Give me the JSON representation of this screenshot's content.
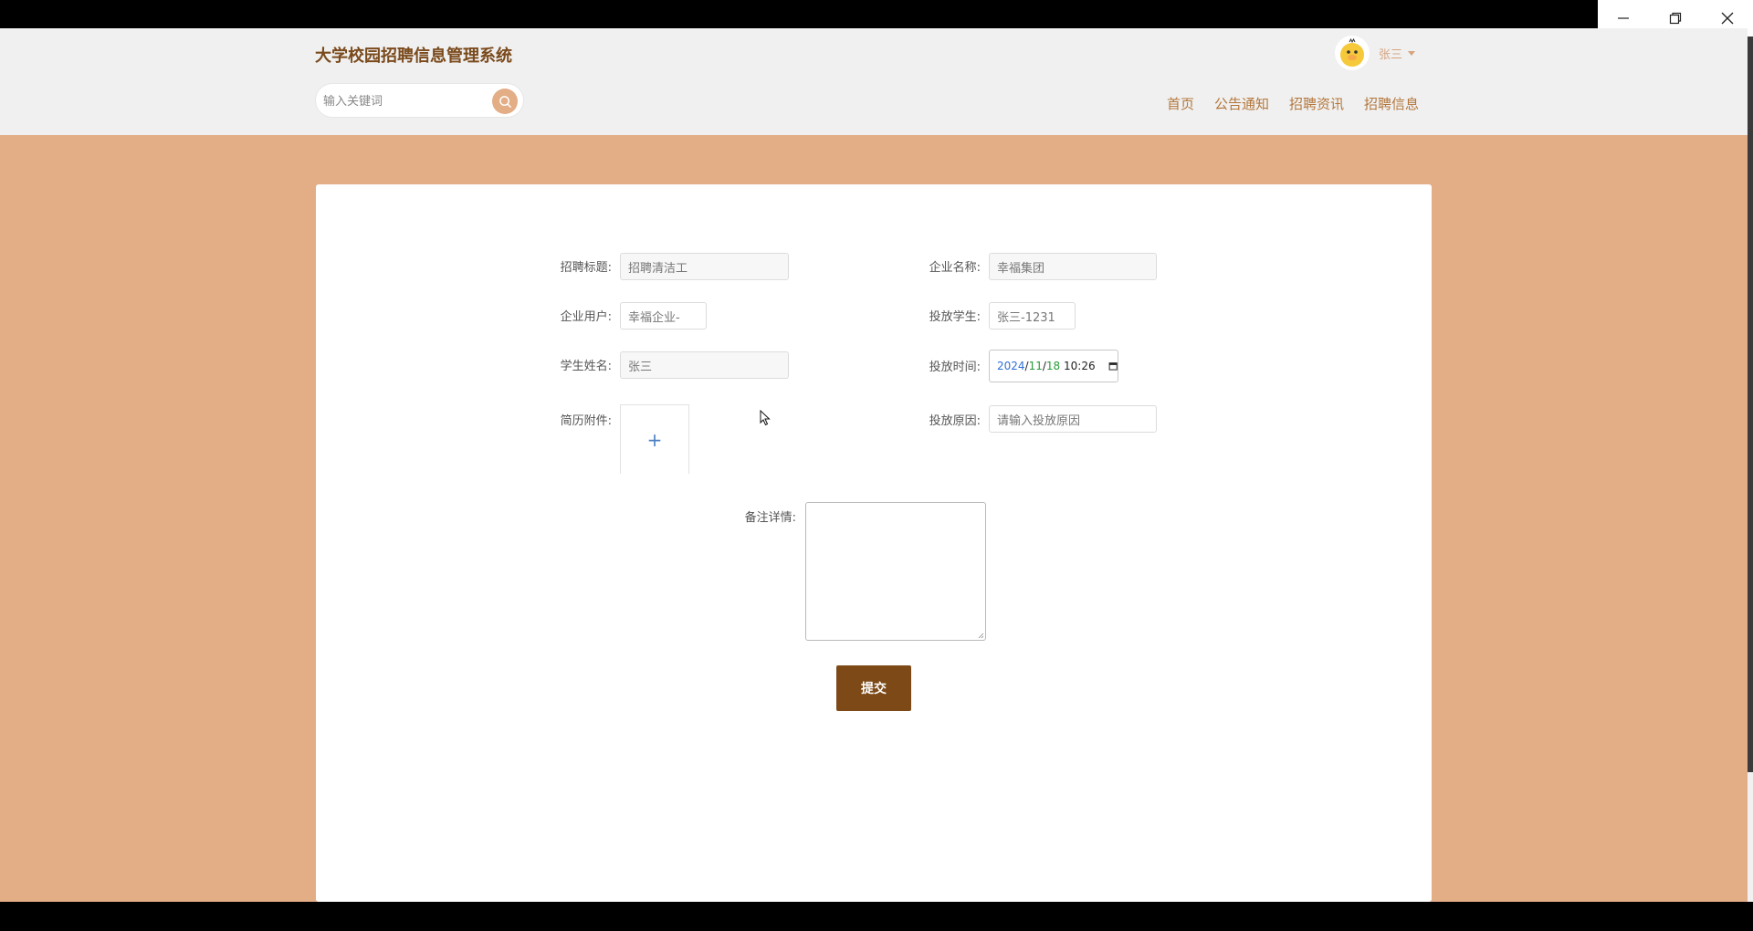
{
  "window": {
    "controls": [
      "minimize",
      "restore",
      "close"
    ]
  },
  "header": {
    "site_title": "大学校园招聘信息管理系统",
    "search_placeholder": "输入关键词",
    "user_name": "张三",
    "nav": [
      "首页",
      "公告通知",
      "招聘资讯",
      "招聘信息"
    ]
  },
  "form": {
    "title_label": "招聘标题:",
    "title_value": "招聘清洁工",
    "company_label": "企业名称:",
    "company_value": "幸福集团",
    "company_user_label": "企业用户:",
    "company_user_value": "幸福企业-",
    "student_label": "投放学生:",
    "student_value": "张三-1231",
    "student_name_label": "学生姓名:",
    "student_name_value": "张三",
    "time_label": "投放时间:",
    "time_year": "2024",
    "time_month": "11",
    "time_day": "18",
    "time_clock": "10:26",
    "resume_label": "简历附件:",
    "upload_plus": "+",
    "reason_label": "投放原因:",
    "reason_placeholder": "请输入投放原因",
    "remark_label": "备注详情:",
    "submit_label": "提交"
  },
  "colors": {
    "background": "#e3ad86",
    "accent": "#7d4a17",
    "nav_text": "#b3773d"
  }
}
